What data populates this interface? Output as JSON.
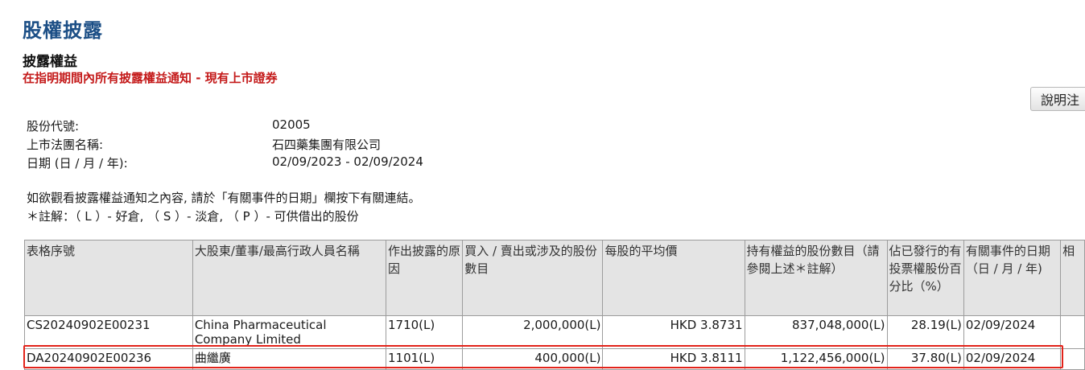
{
  "header": {
    "page_title": "股權披露",
    "section_title": "披露權益",
    "section_subtitle": "在指明期間內所有披露權益通知 - 現有上市證券",
    "explain_button": "說明注"
  },
  "info": {
    "stock_code_label": "股份代號:",
    "stock_code": "02005",
    "company_label": "上市法團名稱:",
    "company": "石四藥集團有限公司",
    "date_label": "日期 (日 / 月 / 年):",
    "date_range": "02/09/2023 - 02/09/2024"
  },
  "notes": {
    "line1": "如欲觀看披露權益通知之內容, 請於「有關事件的日期」欄按下有關連結。",
    "line2": "＊註解：（ L ）- 好倉, （ S ）- 淡倉, （ P ）- 可供借出的股份"
  },
  "table": {
    "headers": [
      "表格序號",
      "大股東/董事/最高行政人員名稱",
      "作出披露的原因",
      "買入 / 賣出或涉及的股份數目",
      "每股的平均價",
      "持有權益的股份數目（請參閱上述＊註解）",
      "佔已發行的有投票權股份百分比（%）",
      "有關事件的日期（日 / 月 / 年)",
      "相"
    ],
    "rows": [
      {
        "form_no": "CS20240902E00231",
        "name": "China Pharmaceutical Company Limited",
        "reason": "1710(L)",
        "shares_traded": "2,000,000(L)",
        "avg_price": "HKD 3.8731",
        "shares_held": "837,048,000(L)",
        "percentage": "28.19(L)",
        "event_date": "02/09/2024"
      },
      {
        "form_no": "DA20240902E00236",
        "name": "曲繼廣",
        "reason": "1101(L)",
        "shares_traded": "400,000(L)",
        "avg_price": "HKD 3.8111",
        "shares_held": "1,122,456,000(L)",
        "percentage": "37.80(L)",
        "event_date": "02/09/2024"
      }
    ]
  },
  "colors": {
    "title_blue": "#1c4f86",
    "subtitle_red": "#c41a1a",
    "highlight_red": "#e2231a",
    "header_gray": "#e4e4e4"
  }
}
